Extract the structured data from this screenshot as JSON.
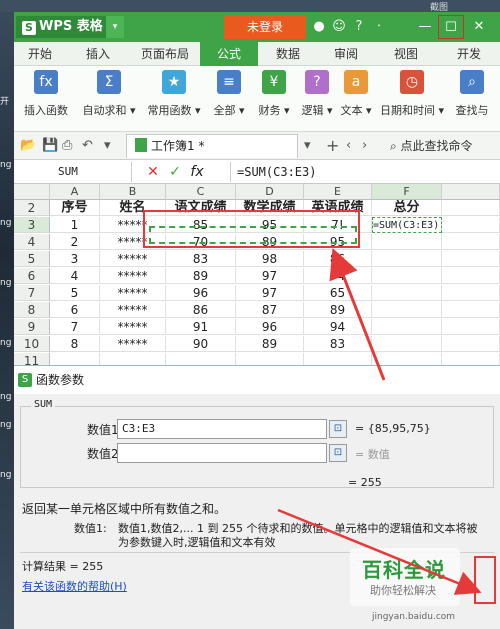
{
  "desktop": {
    "labels": [
      "开",
      "ng",
      "ng",
      "ng",
      "ng",
      "ng",
      "ng",
      "ng"
    ],
    "top_text": "截图"
  },
  "titlebar": {
    "app_name": "WPS 表格",
    "login": "未登录",
    "icons": [
      "●",
      "☺",
      "?",
      "⋅"
    ]
  },
  "tabs": [
    "开始",
    "插入",
    "页面布局",
    "公式",
    "数据",
    "审阅",
    "视图",
    "开发"
  ],
  "active_tab": "公式",
  "ribbon": [
    {
      "label": "插入函数",
      "icon": "fx",
      "color": "#4a7fc8"
    },
    {
      "label": "自动求和 ▾",
      "icon": "Σ",
      "color": "#4a7fc8"
    },
    {
      "label": "常用函数 ▾",
      "icon": "★",
      "color": "#3fa8d8"
    },
    {
      "label": "全部 ▾",
      "icon": "≡",
      "color": "#4a7fc8"
    },
    {
      "label": "财务 ▾",
      "icon": "¥",
      "color": "#3fa348"
    },
    {
      "label": "逻辑 ▾",
      "icon": "?",
      "color": "#b06fc8"
    },
    {
      "label": "文本 ▾",
      "icon": "a",
      "color": "#e89a3a"
    },
    {
      "label": "日期和时间 ▾",
      "icon": "◷",
      "color": "#d8533a"
    },
    {
      "label": "查找与",
      "icon": "⌕",
      "color": "#4a7fc8"
    }
  ],
  "doc_tab": "工作簿1 *",
  "find_cmd": "点此查找命令",
  "namebox": "SUM",
  "formula": "=SUM(C3:E3)",
  "columns": [
    "A",
    "B",
    "C",
    "D",
    "E",
    "F"
  ],
  "headers": [
    "序号",
    "姓名",
    "语文成绩",
    "数学成绩",
    "英语成绩",
    "总分"
  ],
  "rows": [
    [
      "1",
      "*****",
      "85",
      "95",
      "7!",
      "=SUM(C3:E3)"
    ],
    [
      "2",
      "*****",
      "70",
      "89",
      "95",
      ""
    ],
    [
      "3",
      "*****",
      "83",
      "98",
      "86",
      ""
    ],
    [
      "4",
      "*****",
      "89",
      "97",
      "74",
      ""
    ],
    [
      "5",
      "*****",
      "96",
      "97",
      "65",
      ""
    ],
    [
      "6",
      "*****",
      "86",
      "87",
      "89",
      ""
    ],
    [
      "7",
      "*****",
      "91",
      "96",
      "94",
      ""
    ],
    [
      "8",
      "*****",
      "90",
      "89",
      "83",
      ""
    ]
  ],
  "row_numbers": [
    "2",
    "3",
    "4",
    "5",
    "6",
    "7",
    "8",
    "9",
    "10",
    "11"
  ],
  "dialog": {
    "title": "函数参数",
    "func": "SUM",
    "arg1_label": "数值1",
    "arg1_value": "C3:E3",
    "arg1_result": "= {85,95,75}",
    "arg2_label": "数值2",
    "arg2_result": "= 数值",
    "total": "= 255",
    "desc": "返回某一单元格区域中所有数值之和。",
    "param_name": "数值1:",
    "param_desc1": "数值1,数值2,... 1 到 255 个待求和的数值。单元格中的逻辑值和文本将被",
    "param_desc2": "为参数键入时,逻辑值和文本有效",
    "calc_result": "计算结果 = 255",
    "help_link": "有关该函数的帮助(H)"
  },
  "watermark": {
    "big": "百科全说",
    "small": "助你轻松解决",
    "url": "jingyan.baidu.com"
  }
}
